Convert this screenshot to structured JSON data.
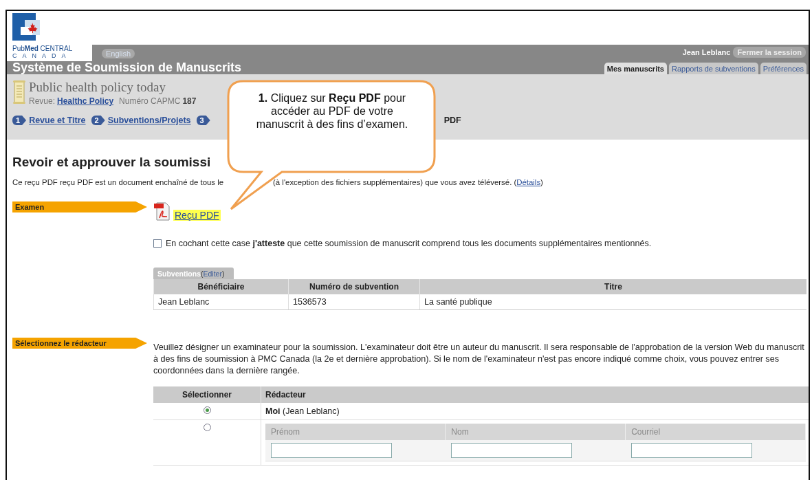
{
  "header": {
    "brand": "Pub**Med** CENTRAL",
    "brand_country": "CANADA",
    "language_button": "English",
    "user_name": "Jean Leblanc",
    "logout_button": "Fermer la session",
    "title": "Système de Soumission de Manuscrits",
    "tabs": [
      {
        "label": "Mes manuscrits",
        "selected": true
      },
      {
        "label": "Rapports de subventions",
        "selected": false
      },
      {
        "label": "Préférences",
        "selected": false
      }
    ]
  },
  "manuscript": {
    "title": "Public health policy today",
    "journal_label": "Revue:",
    "journal_link": "Healthc Policy",
    "number_label": "Numéro CAPMC",
    "number": "187"
  },
  "steps": [
    {
      "kind": "link",
      "number": "1",
      "label": "Revue et Titre"
    },
    {
      "kind": "link",
      "number": "2",
      "label": "Subventions/Projets"
    },
    {
      "kind": "badge",
      "number": "3"
    }
  ],
  "current_step_visible": "PDF",
  "page_heading": "Revoir et approuver la soumissi",
  "intro": {
    "before": "Ce reçu PDF reçu PDF est un document enchaîné de tous le",
    "after": "(à l'exception des fichiers supplémentaires) que vous avez téléversé. (",
    "details_link": "Détails",
    "close": ")"
  },
  "review": {
    "label": "Examen",
    "pdf_link": "Reçu PDF",
    "attest_checkbox": {
      "checked": false,
      "text": "En cochant cette case **j'atteste** que cette soumission de manuscrit comprend tous les documents supplémentaires mentionnés."
    }
  },
  "grants": {
    "tab_label": "Subventions",
    "edit_open": "(",
    "edit_link": "Editer",
    "edit_close": ")",
    "columns": [
      "Bénéficiaire",
      "Numéro de subvention",
      "Titre"
    ],
    "rows": [
      [
        "Jean Leblanc",
        "1536573",
        "La santé publique"
      ]
    ]
  },
  "reviewer": {
    "label": "Sélectionnez le rédacteur",
    "instructions": "Veuillez désigner un examinateur pour la soumission. L'examinateur doit être un auteur du manuscrit. Il sera responsable de l'approbation de la version Web du manuscrit à des fins de soumission à PMC Canada (la 2e et dernière approbation). Si le nom de l'examinateur n'est pas encore indiqué comme choix, vous pouvez entrer ses coordonnées dans la dernière rangée.",
    "columns": [
      "Sélectionner",
      "Rédacteur"
    ],
    "options": [
      {
        "kind": "self",
        "selected": true,
        "text": "**Moi** (Jean Leblanc)"
      },
      {
        "kind": "new",
        "selected": false,
        "fields": [
          "Prénom",
          "Nom",
          "Courriel"
        ]
      }
    ]
  },
  "callout": "**1.** Cliquez sur **Reçu PDF** pour accéder au PDF de votre manuscrit à des fins d’examen."
}
